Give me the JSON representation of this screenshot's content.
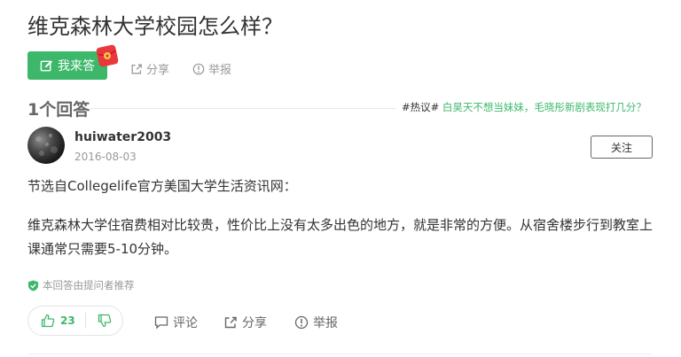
{
  "question": {
    "title": "维克森林大学校园怎么样？"
  },
  "actions": {
    "answer_label": "我来答",
    "share_label": "分享",
    "report_label": "举报"
  },
  "answers_header": {
    "count_label": "1个回答",
    "hot_tag": "#热议#",
    "hot_text": " 白昊天不想当妹妹，毛晓彤新剧表现打几分？"
  },
  "answer": {
    "username": "huiwater2003",
    "date": "2016-08-03",
    "follow_label": "关注",
    "paragraph1": "节选自Collegelife官方美国大学生活资讯网：",
    "paragraph2": "维克森林大学住宿费相对比较贵，性价比上没有太多出色的地方，就是非常的方便。从宿舍楼步行到教室上课通常只需要5-10分钟。",
    "recommend_text": "本回答由提问者推荐",
    "upvotes": "23",
    "comment_label": "评论",
    "share_label": "分享",
    "report_label": "举报"
  },
  "colors": {
    "accent": "#3db86b",
    "text": "#333333",
    "muted": "#999999",
    "redpacket": "#e8383d"
  },
  "icons": [
    "edit-icon",
    "red-packet-icon",
    "share-icon",
    "report-icon",
    "shield-check-icon",
    "thumb-up-icon",
    "thumb-down-icon",
    "comment-icon"
  ]
}
